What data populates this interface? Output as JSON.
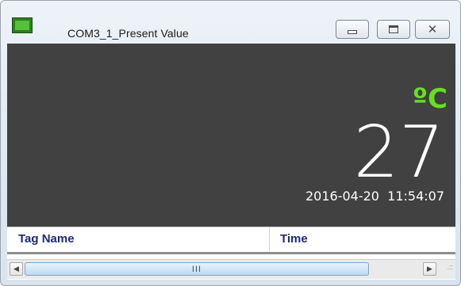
{
  "window": {
    "title": "COM3_1_Present Value",
    "controls": {
      "minimize_icon": "minimize-icon",
      "maximize_icon": "maximize-icon",
      "close_icon": "close-icon",
      "close_glyph": "✕"
    }
  },
  "display": {
    "unit": "ºC",
    "value": "27",
    "timestamp": "2016-04-20  11:54:07",
    "colors": {
      "background": "#414141",
      "unit": "#66e021",
      "value": "#ffffff"
    }
  },
  "table": {
    "columns": [
      "Tag Name",
      "Time"
    ]
  },
  "scrollbar": {
    "left_arrow": "◀",
    "right_arrow": "▶",
    "thumb_grip": "III",
    "resize_grip": ".::"
  }
}
